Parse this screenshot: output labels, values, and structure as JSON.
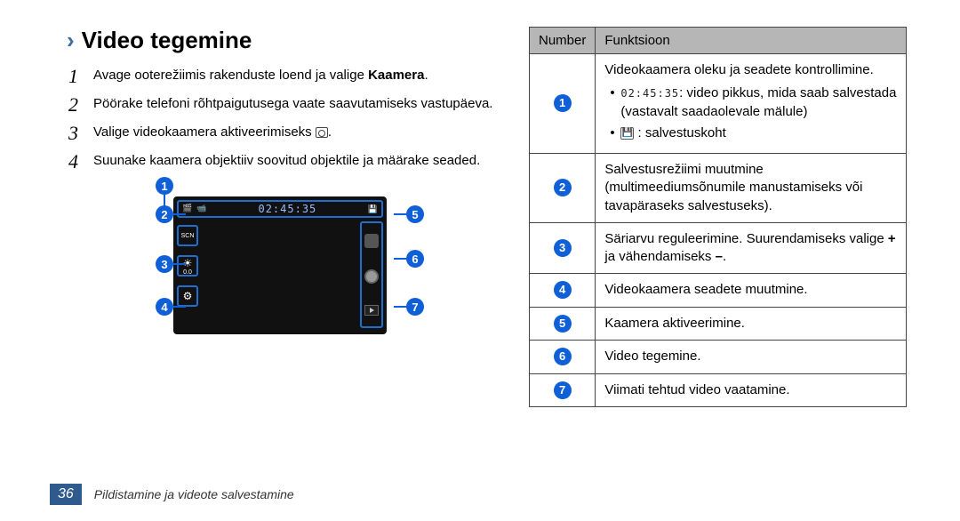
{
  "heading": {
    "title": "Video tegemine"
  },
  "steps": [
    {
      "num": "1",
      "prefix": "Avage ooterežiimis rakenduste loend ja valige ",
      "bold": "Kaamera",
      "suffix": "."
    },
    {
      "num": "2",
      "text": "Pöörake telefoni rõhtpaigutusega vaate saavutamiseks vastupäeva."
    },
    {
      "num": "3",
      "prefix": "Valige videokaamera aktiveerimiseks ",
      "icon": "camera",
      "suffix": "."
    },
    {
      "num": "4",
      "text": "Suunake kaamera objektiiv soovitud objektile ja määrake seaded."
    }
  ],
  "callouts": [
    "1",
    "2",
    "3",
    "4",
    "5",
    "6",
    "7"
  ],
  "table": {
    "headers": {
      "num": "Number",
      "func": "Funktsioon"
    },
    "rows": [
      {
        "badge": "1",
        "intro": "Videokaamera oleku ja seadete kontrollimine.",
        "bullets": [
          {
            "time": "02:45:35",
            "text_after": ": video pikkus, mida saab salvestada (vastavalt saadaolevale mälule)"
          },
          {
            "icon": "save",
            "text_after": " : salvestuskoht"
          }
        ]
      },
      {
        "badge": "2",
        "text": "Salvestusrežiimi muutmine (multimeediumsõnumile manustamiseks või tavapäraseks salvestuseks)."
      },
      {
        "badge": "3",
        "text_pre": "Säriarvu reguleerimine. Suurendamiseks valige ",
        "bold1": "+",
        "mid": " ja vähendamiseks ",
        "bold2": "–",
        "post": "."
      },
      {
        "badge": "4",
        "text": "Videokaamera seadete muutmine."
      },
      {
        "badge": "5",
        "text": "Kaamera aktiveerimine."
      },
      {
        "badge": "6",
        "text": "Video tegemine."
      },
      {
        "badge": "7",
        "text": "Viimati tehtud video vaatamine."
      }
    ]
  },
  "preview": {
    "time_chip": "02:45:35",
    "exp_value": "0.0",
    "scn_label": "SCN"
  },
  "footer": {
    "page": "36",
    "section": "Pildistamine ja videote salvestamine"
  }
}
